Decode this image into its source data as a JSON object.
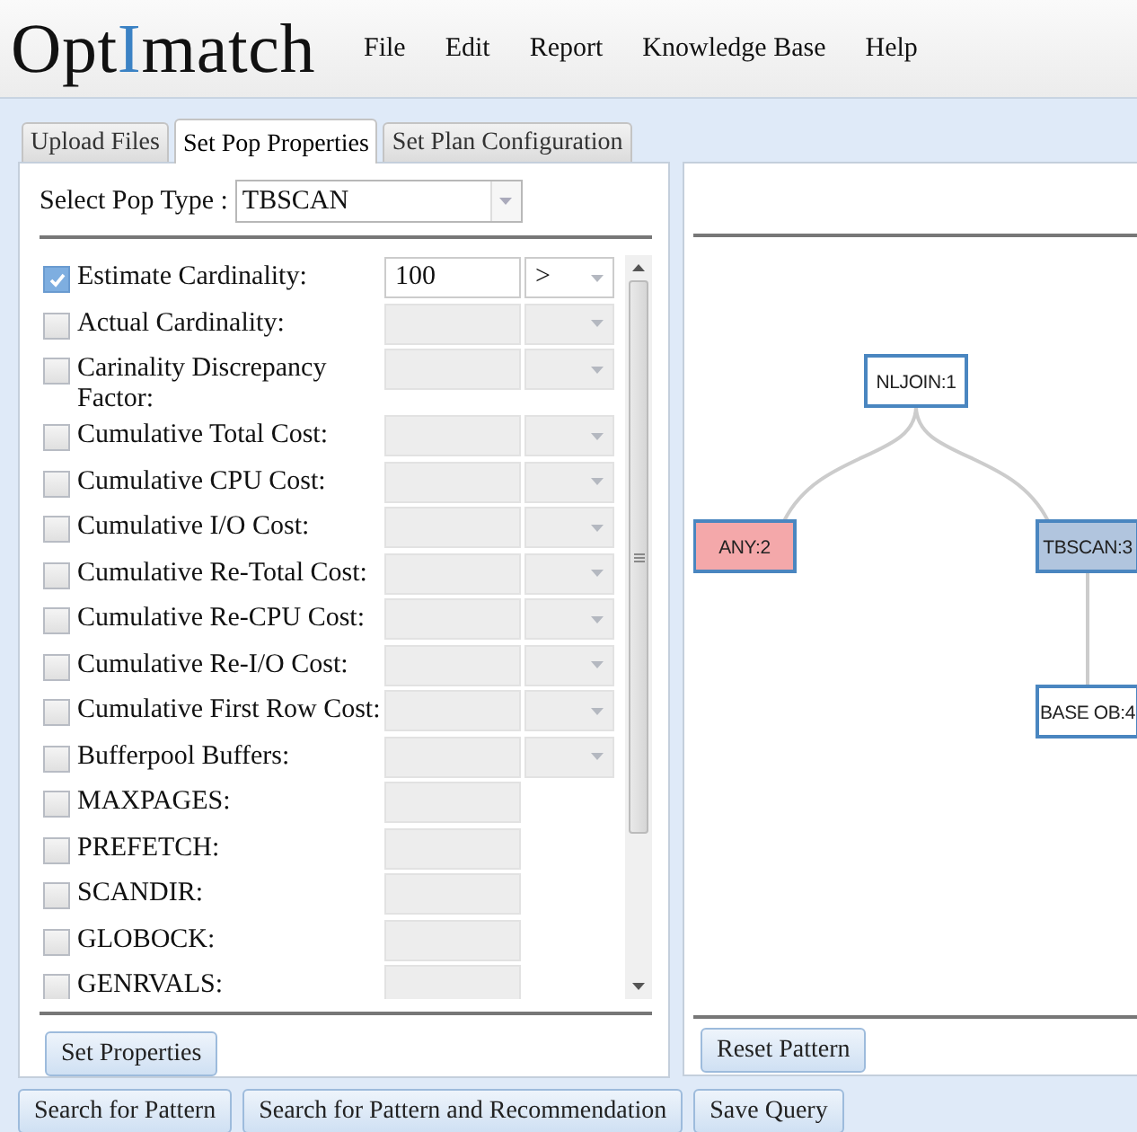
{
  "header": {
    "logo": [
      {
        "text": "Opt",
        "accent": false
      },
      {
        "text": "I",
        "accent": true
      },
      {
        "text": "match",
        "accent": false
      }
    ],
    "menu": [
      "File",
      "Edit",
      "Report",
      "Knowledge Base",
      "Help"
    ]
  },
  "tabs": [
    {
      "label": "Upload Files",
      "selected": false
    },
    {
      "label": "Set Pop Properties",
      "selected": true
    },
    {
      "label": "Set Plan Configuration",
      "selected": false
    }
  ],
  "pop_type": {
    "label": "Select Pop Type :",
    "value": "TBSCAN"
  },
  "properties": [
    {
      "kind": "compare",
      "label": "Estimate Cardinality:",
      "checked": true,
      "value": "100",
      "operator": ">"
    },
    {
      "kind": "compare",
      "label": "Actual Cardinality:",
      "checked": false
    },
    {
      "kind": "compare",
      "label": "Carinality Discrepancy Factor:",
      "checked": false
    },
    {
      "kind": "compare",
      "label": "Cumulative Total Cost:",
      "checked": false
    },
    {
      "kind": "compare",
      "label": "Cumulative CPU Cost:",
      "checked": false
    },
    {
      "kind": "compare",
      "label": "Cumulative I/O Cost:",
      "checked": false
    },
    {
      "kind": "compare",
      "label": "Cumulative Re-Total Cost:",
      "checked": false
    },
    {
      "kind": "compare",
      "label": "Cumulative Re-CPU Cost:",
      "checked": false
    },
    {
      "kind": "compare",
      "label": "Cumulative Re-I/O Cost:",
      "checked": false
    },
    {
      "kind": "compare",
      "label": "Cumulative First Row Cost:",
      "checked": false
    },
    {
      "kind": "compare",
      "label": "Bufferpool Buffers:",
      "checked": false
    },
    {
      "kind": "single",
      "label": "MAXPAGES:",
      "checked": false
    },
    {
      "kind": "single",
      "label": "PREFETCH:",
      "checked": false
    },
    {
      "kind": "single",
      "label": "SCANDIR:",
      "checked": false
    },
    {
      "kind": "single",
      "label": "GLOBOCK:",
      "checked": false
    },
    {
      "kind": "single",
      "label": "GENRVALS:",
      "checked": false
    }
  ],
  "set_button": "Set Properties",
  "pattern": {
    "label": "NLJOIN:1",
    "color": "#ffffff",
    "children": [
      {
        "label": "ANY:2",
        "color": "#f4a8aa"
      },
      {
        "label": "TBSCAN:3",
        "color": "#b1c5de",
        "children": [
          {
            "label": "BASE OB:4",
            "color": "#ffffff"
          }
        ]
      }
    ]
  },
  "reset_button": "Reset Pattern",
  "actions": [
    "Search for Pattern",
    "Search for Pattern and Recommendation",
    "Save Query"
  ]
}
